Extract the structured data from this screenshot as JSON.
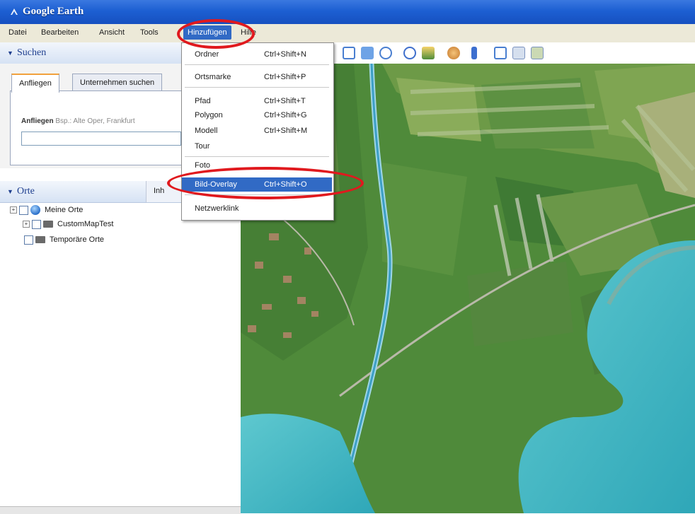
{
  "window": {
    "title": "Google Earth"
  },
  "menubar": {
    "items": [
      {
        "label": "Datei"
      },
      {
        "label": "Bearbeiten"
      },
      {
        "label": "Ansicht"
      },
      {
        "label": "Tools"
      },
      {
        "label": "Hinzufügen"
      },
      {
        "label": "Hilfe"
      }
    ]
  },
  "search": {
    "header": "Suchen",
    "tabs": [
      {
        "label": "Anfliegen"
      },
      {
        "label": "Unternehmen suchen"
      }
    ],
    "hint_bold": "Anfliegen",
    "hint_text": "Bsp.: Alte Oper, Frankfurt",
    "input_value": ""
  },
  "places": {
    "header": "Orte",
    "extra_tab": "Inh",
    "tree": [
      {
        "label": "Meine Orte"
      },
      {
        "label": "CustomMapTest"
      },
      {
        "label": "Temporäre Orte"
      }
    ]
  },
  "dropdown": {
    "items": [
      {
        "label": "Ordner",
        "shortcut": "Ctrl+Shift+N"
      },
      {
        "label": "Ortsmarke",
        "shortcut": "Ctrl+Shift+P"
      },
      {
        "label": "Pfad",
        "shortcut": "Ctrl+Shift+T"
      },
      {
        "label": "Polygon",
        "shortcut": "Ctrl+Shift+G"
      },
      {
        "label": "Modell",
        "shortcut": "Ctrl+Shift+M"
      },
      {
        "label": "Tour",
        "shortcut": ""
      },
      {
        "label": "Foto",
        "shortcut": ""
      },
      {
        "label": "Bild-Overlay",
        "shortcut": "Ctrl+Shift+O"
      },
      {
        "label": "Netzwerklink",
        "shortcut": ""
      }
    ],
    "highlighted_index": 7
  },
  "toolbar": {
    "icons": [
      "placemark-icon",
      "polygon-icon",
      "path-icon",
      "overlay-icon",
      "tour-icon",
      "history-icon",
      "sun-icon",
      "planet-icon",
      "ruler-icon",
      "email-icon",
      "print-icon",
      "map-view-icon"
    ]
  },
  "colors": {
    "menu_highlight": "#316ac5",
    "annotation": "#e0191e",
    "water": "#3fb6c4",
    "fields": "#4f8a3a"
  }
}
